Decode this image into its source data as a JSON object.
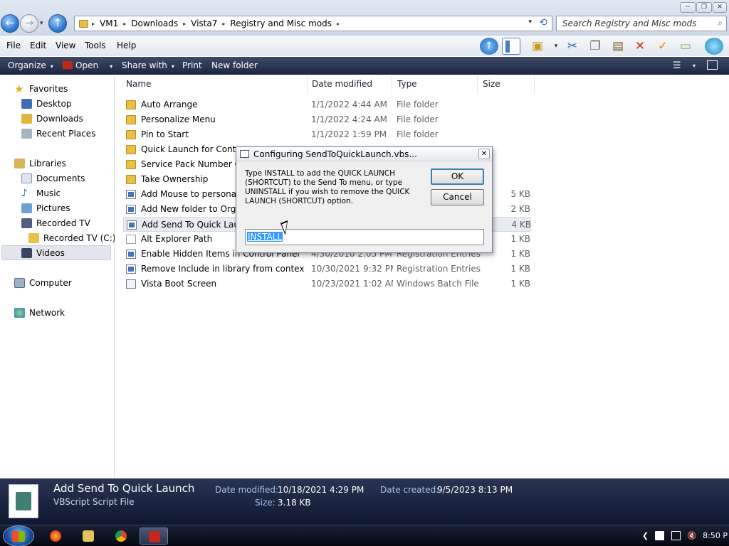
{
  "window": {
    "min_glyph": "─",
    "max_glyph": "❐",
    "close_glyph": "✕"
  },
  "nav": {
    "back_glyph": "←",
    "forward_glyph": "→",
    "up_glyph": "↑",
    "history_glyph": "▾"
  },
  "address": {
    "crumbs": [
      "VM1",
      "Downloads",
      "Vista7",
      "Registry and Misc mods"
    ],
    "separator": "▸",
    "dropdown_glyph": "▾",
    "refresh_glyph": "⟲"
  },
  "search": {
    "placeholder": "Search Registry and Misc mods",
    "icon_glyph": "⌕"
  },
  "menubar": {
    "items": [
      "File",
      "Edit",
      "View",
      "Tools",
      "Help"
    ]
  },
  "commandbar": {
    "organize": "Organize",
    "open": "Open",
    "share": "Share with",
    "print": "Print",
    "new_folder": "New folder",
    "caret": "▾"
  },
  "navpane": {
    "favorites": "Favorites",
    "desktop": "Desktop",
    "downloads": "Downloads",
    "recent": "Recent Places",
    "libraries": "Libraries",
    "documents": "Documents",
    "music": "Music",
    "pictures": "Pictures",
    "recorded_tv": "Recorded TV",
    "recorded_tv_c": "Recorded TV (C:)",
    "videos": "Videos",
    "computer": "Computer",
    "network": "Network"
  },
  "columns": {
    "name": "Name",
    "date": "Date modified",
    "type": "Type",
    "size": "Size"
  },
  "files": [
    {
      "name": "Auto Arrange",
      "date": "1/1/2022 4:44 AM",
      "type": "File folder",
      "size": "",
      "kind": "folder"
    },
    {
      "name": "Personalize Menu",
      "date": "1/1/2022 4:24 AM",
      "type": "File folder",
      "size": "",
      "kind": "folder"
    },
    {
      "name": "Pin to Start",
      "date": "1/1/2022 1:59 PM",
      "type": "File folder",
      "size": "",
      "kind": "folder"
    },
    {
      "name": "Quick Launch for Contex",
      "date": "",
      "type": "",
      "size": "",
      "kind": "folder"
    },
    {
      "name": "Service Pack Number Cha",
      "date": "",
      "type": "",
      "size": "",
      "kind": "folder"
    },
    {
      "name": "Take Ownership",
      "date": "",
      "type": "",
      "size": "",
      "kind": "folder"
    },
    {
      "name": "Add Mouse to personaliz",
      "date": "",
      "type": "",
      "size": "5 KB",
      "kind": "reg"
    },
    {
      "name": "Add New folder to Organ",
      "date": "",
      "type": "",
      "size": "2 KB",
      "kind": "reg"
    },
    {
      "name": "Add Send To Quick Laun",
      "date": "",
      "type": "",
      "size": "4 KB",
      "kind": "vbs"
    },
    {
      "name": "Alt Explorer Path",
      "date": "",
      "type": "",
      "size": "1 KB",
      "kind": "txt"
    },
    {
      "name": "Enable Hidden Items in Control Panel",
      "date": "4/30/2010 2:05 PM",
      "type": "Registration Entries",
      "size": "1 KB",
      "kind": "reg"
    },
    {
      "name": "Remove Include in library from context ...",
      "date": "10/30/2021 9:32 PM",
      "type": "Registration Entries",
      "size": "1 KB",
      "kind": "reg"
    },
    {
      "name": "Vista Boot Screen",
      "date": "10/23/2021 1:02 AM",
      "type": "Windows Batch File",
      "size": "1 KB",
      "kind": "bat"
    }
  ],
  "dialog": {
    "title": "Configuring SendToQuickLaunch.vbs...",
    "close_glyph": "✕",
    "prompt": "Type INSTALL to add the QUICK LAUNCH (SHORTCUT) to the Send To menu, or type UNINSTALL if you wish to remove the QUICK LAUNCH (SHORTCUT) option.",
    "ok": "OK",
    "cancel": "Cancel",
    "input_value": "INSTALL"
  },
  "details": {
    "name": "Add Send To Quick Launch",
    "type": "VBScript Script File",
    "date_modified_label": "Date modified:",
    "date_modified": "10/18/2021 4:29 PM",
    "size_label": "Size:",
    "size": "3.18 KB",
    "date_created_label": "Date created:",
    "date_created": "9/5/2023 8:13 PM"
  },
  "taskbar": {
    "clock": "8:50 P",
    "tray_arrow": "❮"
  },
  "colors": {
    "cmdbar": "#1d2744",
    "selection": "#3399ff",
    "folder": "#e9bf45",
    "accent": "#2a74c9"
  }
}
